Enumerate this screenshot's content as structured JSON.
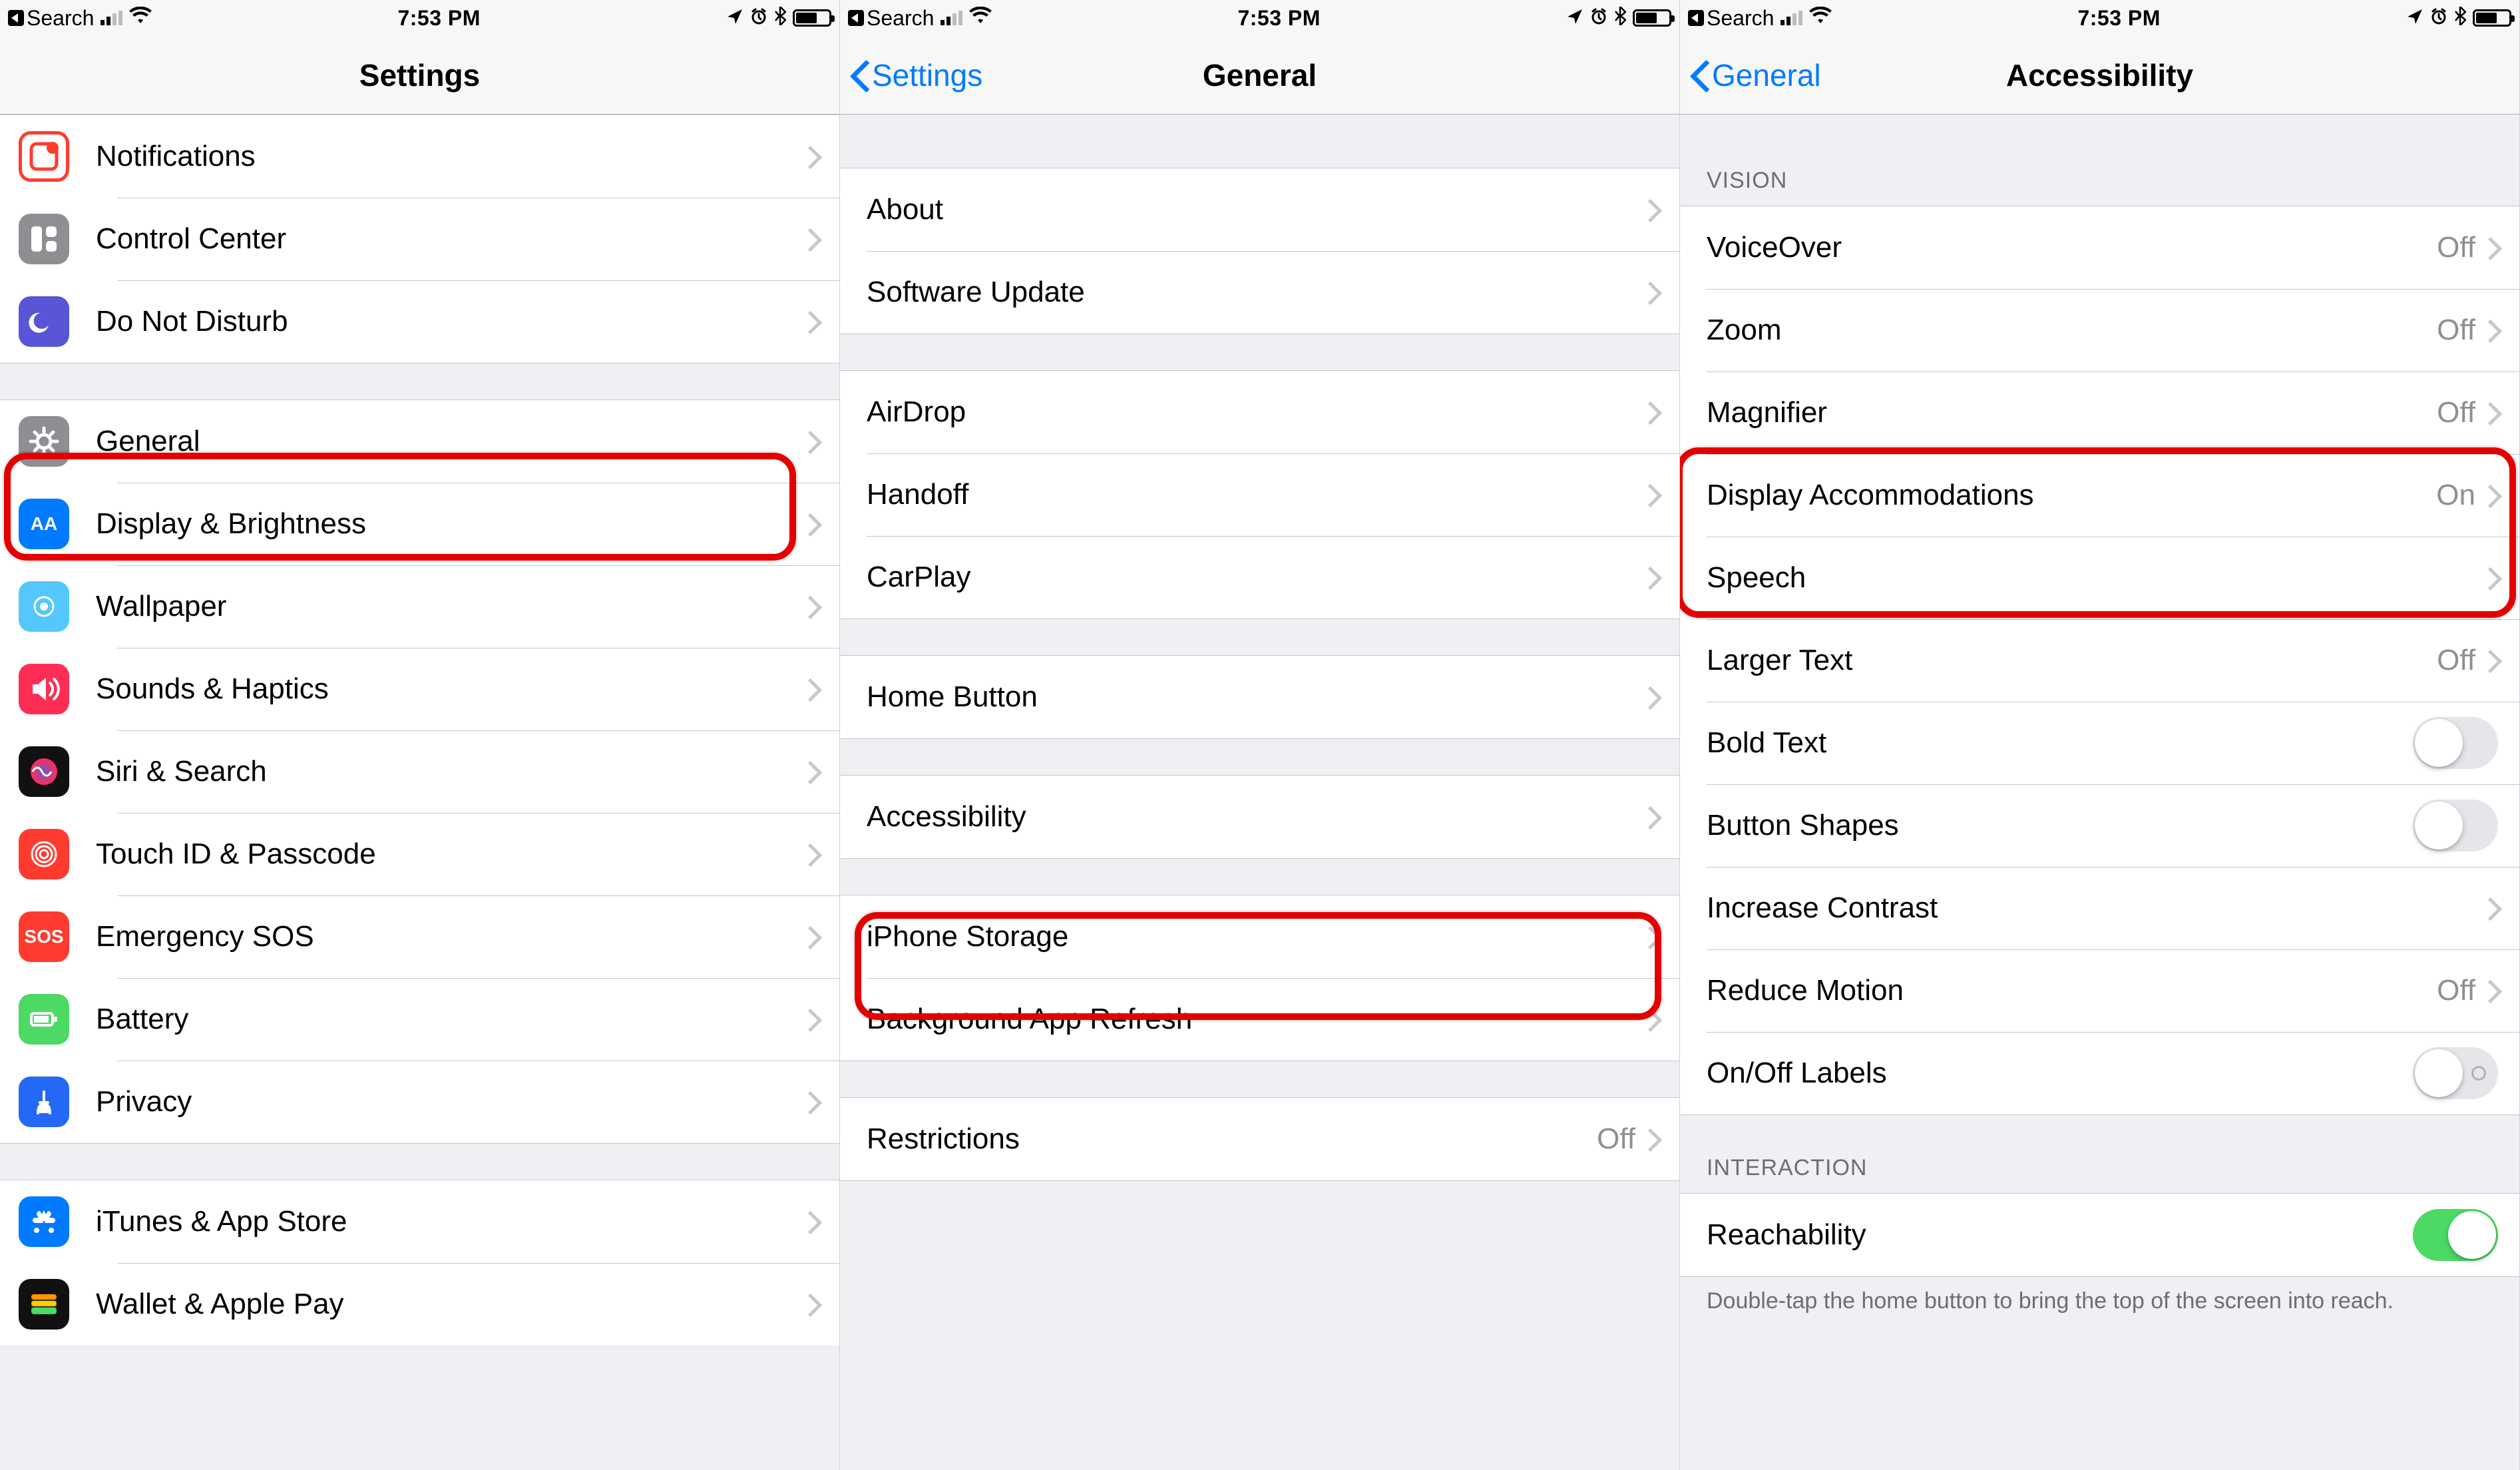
{
  "status": {
    "back_app": "Search",
    "time": "7:53 PM"
  },
  "screen1": {
    "title": "Settings",
    "group_a": [
      {
        "label": "Notifications",
        "icon": "notifications"
      },
      {
        "label": "Control Center",
        "icon": "control-center"
      },
      {
        "label": "Do Not Disturb",
        "icon": "dnd"
      }
    ],
    "group_b": [
      {
        "label": "General",
        "icon": "general",
        "highlight": true
      },
      {
        "label": "Display & Brightness",
        "icon": "display"
      },
      {
        "label": "Wallpaper",
        "icon": "wallpaper"
      },
      {
        "label": "Sounds & Haptics",
        "icon": "sounds"
      },
      {
        "label": "Siri & Search",
        "icon": "siri"
      },
      {
        "label": "Touch ID & Passcode",
        "icon": "touchid"
      },
      {
        "label": "Emergency SOS",
        "icon": "sos"
      },
      {
        "label": "Battery",
        "icon": "battery"
      },
      {
        "label": "Privacy",
        "icon": "privacy"
      }
    ],
    "group_c": [
      {
        "label": "iTunes & App Store",
        "icon": "appstore"
      },
      {
        "label": "Wallet & Apple Pay",
        "icon": "wallet"
      }
    ]
  },
  "screen2": {
    "back": "Settings",
    "title": "General",
    "groups": [
      [
        {
          "label": "About"
        },
        {
          "label": "Software Update"
        }
      ],
      [
        {
          "label": "AirDrop"
        },
        {
          "label": "Handoff"
        },
        {
          "label": "CarPlay"
        }
      ],
      [
        {
          "label": "Home Button"
        }
      ],
      [
        {
          "label": "Accessibility",
          "highlight": true
        }
      ],
      [
        {
          "label": "iPhone Storage"
        },
        {
          "label": "Background App Refresh"
        }
      ],
      [
        {
          "label": "Restrictions",
          "value": "Off"
        }
      ]
    ]
  },
  "screen3": {
    "back": "General",
    "title": "Accessibility",
    "vision_header": "VISION",
    "vision": [
      {
        "label": "VoiceOver",
        "value": "Off",
        "type": "link"
      },
      {
        "label": "Zoom",
        "value": "Off",
        "type": "link"
      },
      {
        "label": "Magnifier",
        "value": "Off",
        "type": "link"
      },
      {
        "label": "Display Accommodations",
        "value": "On",
        "type": "link",
        "highlight": true
      },
      {
        "label": "Speech",
        "type": "link"
      },
      {
        "label": "Larger Text",
        "value": "Off",
        "type": "link"
      },
      {
        "label": "Bold Text",
        "type": "toggle",
        "on": false
      },
      {
        "label": "Button Shapes",
        "type": "toggle",
        "on": false
      },
      {
        "label": "Increase Contrast",
        "type": "link"
      },
      {
        "label": "Reduce Motion",
        "value": "Off",
        "type": "link"
      },
      {
        "label": "On/Off Labels",
        "type": "toggle",
        "on": false,
        "dot": true
      }
    ],
    "interaction_header": "INTERACTION",
    "interaction": [
      {
        "label": "Reachability",
        "type": "toggle",
        "on": true
      }
    ],
    "interaction_note": "Double-tap the home button to bring the top of the screen into reach."
  },
  "icons": {
    "notifications": {
      "cls": "bg-outline-red"
    },
    "control-center": {
      "cls": "bg-gray"
    },
    "dnd": {
      "cls": "bg-purple"
    },
    "general": {
      "cls": "bg-gray"
    },
    "display": {
      "cls": "bg-aa",
      "txt": "AA"
    },
    "wallpaper": {
      "cls": "bg-cyan"
    },
    "sounds": {
      "cls": "bg-pink"
    },
    "siri": {
      "cls": "bg-black"
    },
    "touchid": {
      "cls": "bg-red"
    },
    "sos": {
      "cls": "bg-red",
      "txt": "SOS"
    },
    "battery": {
      "cls": "bg-green"
    },
    "privacy": {
      "cls": "bg-bluehand"
    },
    "appstore": {
      "cls": "bg-blue"
    },
    "wallet": {
      "cls": "bg-black"
    }
  }
}
